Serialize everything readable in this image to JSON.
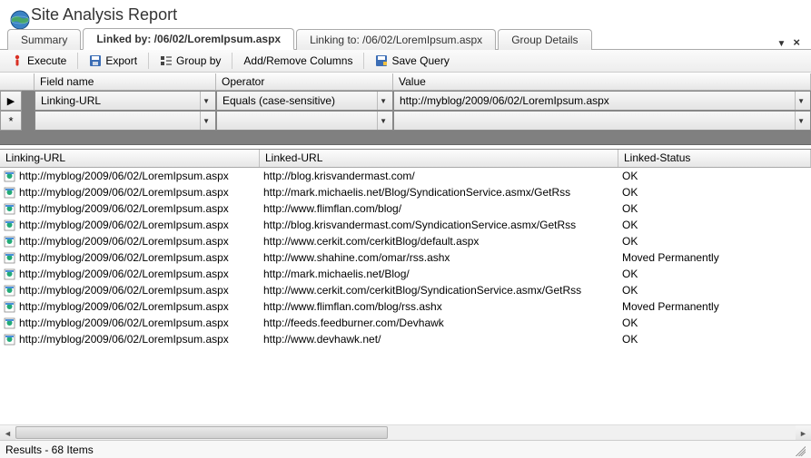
{
  "title": "Site Analysis Report",
  "tabs": [
    {
      "label": "Summary"
    },
    {
      "label": "Linked by: /06/02/LoremIpsum.aspx"
    },
    {
      "label": "Linking to: /06/02/LoremIpsum.aspx"
    },
    {
      "label": "Group Details"
    }
  ],
  "toolbar": {
    "execute": "Execute",
    "export": "Export",
    "groupby": "Group by",
    "addremove": "Add/Remove Columns",
    "savequery": "Save Query"
  },
  "filter": {
    "headers": {
      "field": "Field name",
      "operator": "Operator",
      "value": "Value"
    },
    "rows": [
      {
        "field": "Linking-URL",
        "operator": "Equals (case-sensitive)",
        "value": "http://myblog/2009/06/02/LoremIpsum.aspx"
      },
      {
        "field": "",
        "operator": "",
        "value": ""
      }
    ]
  },
  "grid": {
    "headers": {
      "c1": "Linking-URL",
      "c2": "Linked-URL",
      "c3": "Linked-Status"
    },
    "rows": [
      {
        "c1": "http://myblog/2009/06/02/LoremIpsum.aspx",
        "c2": "http://blog.krisvandermast.com/",
        "c3": "OK"
      },
      {
        "c1": "http://myblog/2009/06/02/LoremIpsum.aspx",
        "c2": "http://mark.michaelis.net/Blog/SyndicationService.asmx/GetRss",
        "c3": "OK"
      },
      {
        "c1": "http://myblog/2009/06/02/LoremIpsum.aspx",
        "c2": "http://www.flimflan.com/blog/",
        "c3": "OK"
      },
      {
        "c1": "http://myblog/2009/06/02/LoremIpsum.aspx",
        "c2": "http://blog.krisvandermast.com/SyndicationService.asmx/GetRss",
        "c3": "OK"
      },
      {
        "c1": "http://myblog/2009/06/02/LoremIpsum.aspx",
        "c2": "http://www.cerkit.com/cerkitBlog/default.aspx",
        "c3": "OK"
      },
      {
        "c1": "http://myblog/2009/06/02/LoremIpsum.aspx",
        "c2": "http://www.shahine.com/omar/rss.ashx",
        "c3": "Moved Permanently"
      },
      {
        "c1": "http://myblog/2009/06/02/LoremIpsum.aspx",
        "c2": "http://mark.michaelis.net/Blog/",
        "c3": "OK"
      },
      {
        "c1": "http://myblog/2009/06/02/LoremIpsum.aspx",
        "c2": "http://www.cerkit.com/cerkitBlog/SyndicationService.asmx/GetRss",
        "c3": "OK"
      },
      {
        "c1": "http://myblog/2009/06/02/LoremIpsum.aspx",
        "c2": "http://www.flimflan.com/blog/rss.ashx",
        "c3": "Moved Permanently"
      },
      {
        "c1": "http://myblog/2009/06/02/LoremIpsum.aspx",
        "c2": "http://feeds.feedburner.com/Devhawk",
        "c3": "OK"
      },
      {
        "c1": "http://myblog/2009/06/02/LoremIpsum.aspx",
        "c2": "http://www.devhawk.net/",
        "c3": "OK"
      }
    ]
  },
  "status": "Results - 68 Items"
}
